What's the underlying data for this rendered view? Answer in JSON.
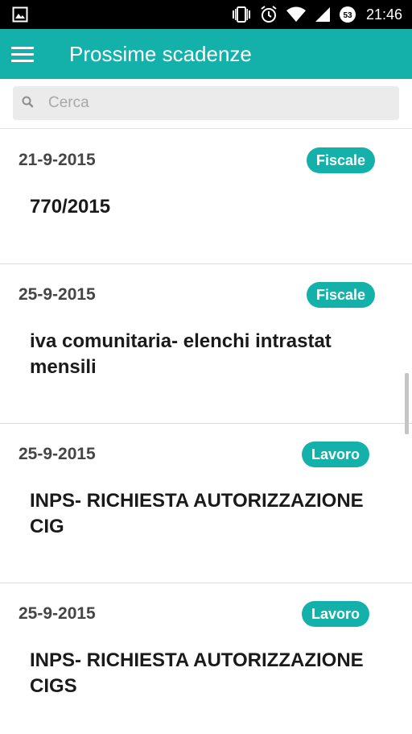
{
  "status_bar": {
    "time": "21:46",
    "notification_count": "53",
    "icons": [
      "image-icon",
      "vibrate-icon",
      "alarm-icon",
      "wifi-icon",
      "signal-icon",
      "battery-icon"
    ]
  },
  "app_bar": {
    "title": "Prossime scadenze",
    "color": "#14b1ab"
  },
  "search": {
    "placeholder": "Cerca",
    "value": ""
  },
  "items": [
    {
      "date": "21-9-2015",
      "category": "Fiscale",
      "title": "770/2015"
    },
    {
      "date": "25-9-2015",
      "category": "Fiscale",
      "title": "iva comunitaria- elenchi intrastat mensili"
    },
    {
      "date": "25-9-2015",
      "category": "Lavoro",
      "title": "INPS- RICHIESTA AUTORIZZAZIONE CIG"
    },
    {
      "date": "25-9-2015",
      "category": "Lavoro",
      "title": "INPS- RICHIESTA AUTORIZZAZIONE CIGS"
    }
  ]
}
